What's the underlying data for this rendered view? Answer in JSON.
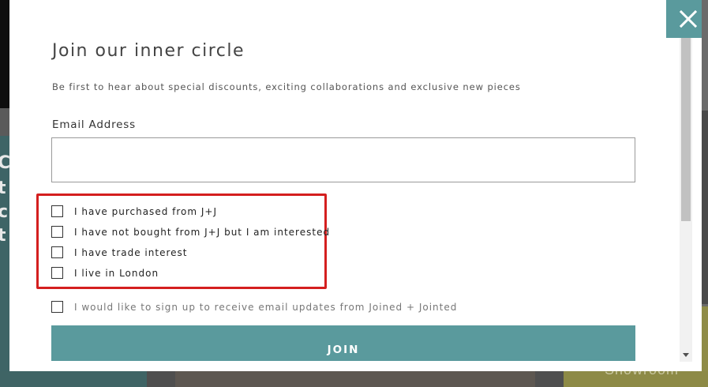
{
  "modal": {
    "title": "Join our inner circle",
    "subtitle": "Be first to hear about special discounts, exciting collaborations and exclusive new pieces",
    "email_label": "Email Address",
    "email_value": "",
    "checkboxes": [
      {
        "label": "I have purchased from J+J",
        "checked": false
      },
      {
        "label": "I have not bought from J+J but I am interested",
        "checked": false
      },
      {
        "label": "I have trade interest",
        "checked": false
      },
      {
        "label": "I live in London",
        "checked": false
      }
    ],
    "newsletter_label": "I would like to sign up to receive email updates from Joined + Jointed",
    "join_label": "JOIN",
    "close_icon": "close-icon"
  },
  "background": {
    "left_letters": [
      "C",
      "t",
      "c",
      "t"
    ],
    "bottom_right_text": "Showroom"
  },
  "colors": {
    "accent": "#5a9a9d",
    "highlight_border": "#d41f1f"
  }
}
